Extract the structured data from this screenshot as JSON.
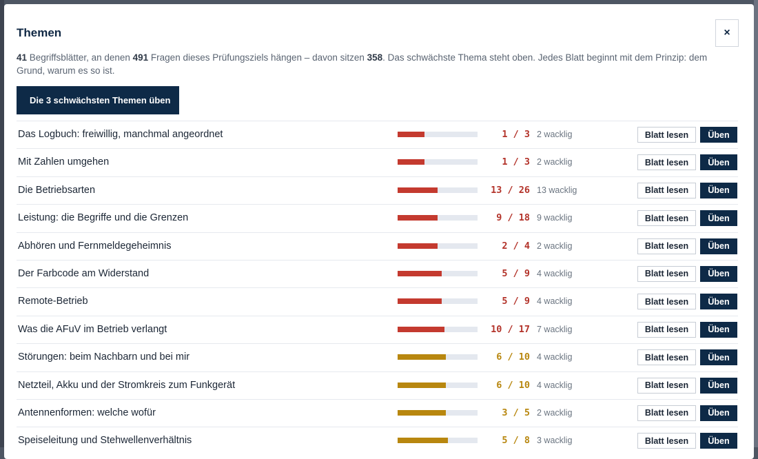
{
  "modal": {
    "title": "Themen",
    "close_label": "×",
    "intro": {
      "sheets_count": "41",
      "text_1": " Begriffsblätter, an denen ",
      "questions_count": "491",
      "text_2": " Fragen dieses Prüfungsziels hängen – davon sitzen ",
      "mastered_count": "358",
      "text_3": ". Das schwächste Thema steht oben. Jedes Blatt beginnt mit dem Prinzip: dem Grund, warum es so ist."
    },
    "practice_weakest_label": "Die 3 schwächsten Themen üben"
  },
  "colors": {
    "red": "#c43a2f",
    "gold": "#b8870f",
    "navy": "#0e2a47"
  },
  "row_labels": {
    "read": "Blatt lesen",
    "practice": "Üben"
  },
  "topics": [
    {
      "name": "Das Logbuch: freiwillig, manchmal angeordnet",
      "score": "1 / 3",
      "progress": 0.333,
      "wobbly": "2 wacklig",
      "level": "red"
    },
    {
      "name": "Mit Zahlen umgehen",
      "score": "1 / 3",
      "progress": 0.333,
      "wobbly": "2 wacklig",
      "level": "red"
    },
    {
      "name": "Die Betriebsarten",
      "score": "13 / 26",
      "progress": 0.5,
      "wobbly": "13 wacklig",
      "level": "red"
    },
    {
      "name": "Leistung: die Begriffe und die Grenzen",
      "score": "9 / 18",
      "progress": 0.5,
      "wobbly": "9 wacklig",
      "level": "red"
    },
    {
      "name": "Abhören und Fernmeldegeheimnis",
      "score": "2 / 4",
      "progress": 0.5,
      "wobbly": "2 wacklig",
      "level": "red"
    },
    {
      "name": "Der Farbcode am Widerstand",
      "score": "5 / 9",
      "progress": 0.556,
      "wobbly": "4 wacklig",
      "level": "red"
    },
    {
      "name": "Remote-Betrieb",
      "score": "5 / 9",
      "progress": 0.556,
      "wobbly": "4 wacklig",
      "level": "red"
    },
    {
      "name": "Was die AFuV im Betrieb verlangt",
      "score": "10 / 17",
      "progress": 0.588,
      "wobbly": "7 wacklig",
      "level": "red"
    },
    {
      "name": "Störungen: beim Nachbarn und bei mir",
      "score": "6 / 10",
      "progress": 0.6,
      "wobbly": "4 wacklig",
      "level": "gold"
    },
    {
      "name": "Netzteil, Akku und der Stromkreis zum Funkgerät",
      "score": "6 / 10",
      "progress": 0.6,
      "wobbly": "4 wacklig",
      "level": "gold"
    },
    {
      "name": "Antennenformen: welche wofür",
      "score": "3 / 5",
      "progress": 0.6,
      "wobbly": "2 wacklig",
      "level": "gold"
    },
    {
      "name": "Speiseleitung und Stehwellenverhältnis",
      "score": "5 / 8",
      "progress": 0.625,
      "wobbly": "3 wacklig",
      "level": "gold"
    }
  ]
}
